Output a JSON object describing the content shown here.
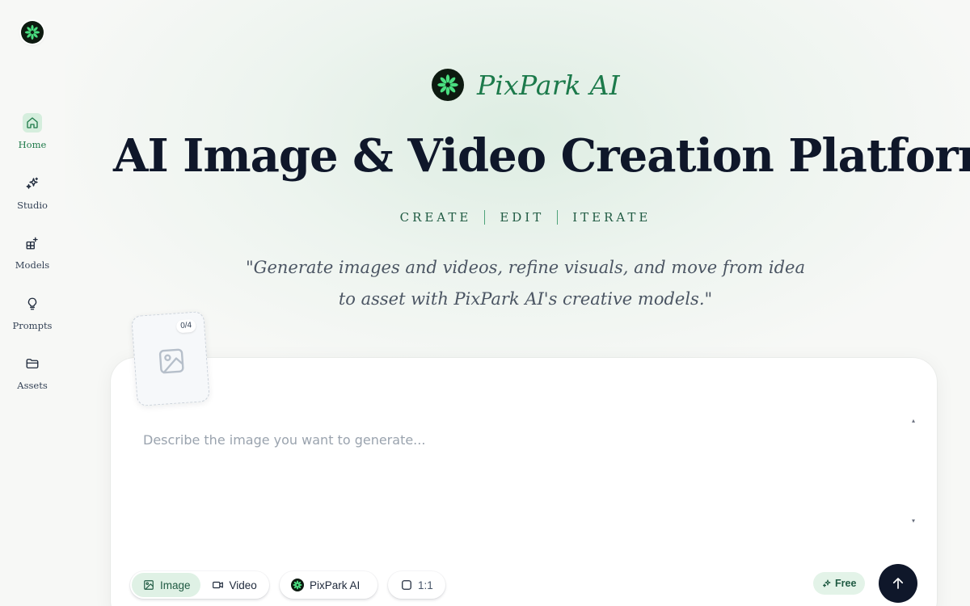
{
  "brand": {
    "name": "PixPark AI"
  },
  "sidebar": {
    "items": [
      {
        "label": "Home",
        "icon": "home-icon",
        "active": true
      },
      {
        "label": "Studio",
        "icon": "sparkles-icon",
        "active": false
      },
      {
        "label": "Models",
        "icon": "grid-plus-icon",
        "active": false
      },
      {
        "label": "Prompts",
        "icon": "lightbulb-icon",
        "active": false
      },
      {
        "label": "Assets",
        "icon": "folder-icon",
        "active": false
      }
    ]
  },
  "hero": {
    "title": "AI Image & Video Creation Platform",
    "tagline": [
      "CREATE",
      "EDIT",
      "ITERATE"
    ],
    "subtitle_line1": "\"Generate images and videos, refine visuals, and move from idea",
    "subtitle_line2": "to asset with PixPark AI's creative models.\""
  },
  "composer": {
    "upload_count": "0/4",
    "placeholder": "Describe the image you want to generate...",
    "mode_tabs": [
      {
        "label": "Image",
        "icon": "image-icon",
        "active": true
      },
      {
        "label": "Video",
        "icon": "video-icon",
        "active": false
      }
    ],
    "model_label": "PixPark AI",
    "aspect_ratio": "1:1",
    "free_label": "Free"
  },
  "colors": {
    "accent": "#1c7a4b",
    "active_bg": "#dff1e5",
    "submit_bg": "#0f172a"
  }
}
